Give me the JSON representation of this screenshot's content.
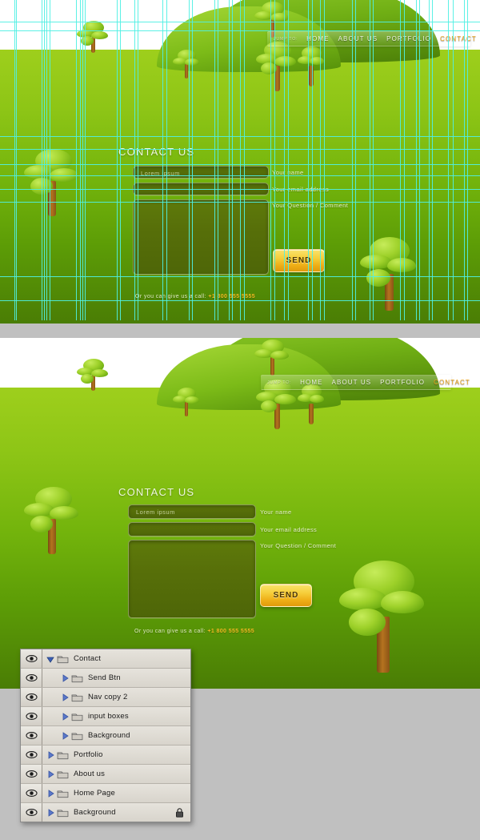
{
  "panels": {
    "top": {
      "label": "design-with-guides"
    },
    "bottom": {
      "label": "design-preview"
    }
  },
  "nav": {
    "jump_label": "JUMP TO:",
    "items": [
      {
        "label": "HOME",
        "active": false
      },
      {
        "label": "ABOUT US",
        "active": false
      },
      {
        "label": "PORTFOLIO",
        "active": false
      },
      {
        "label": "CONTACT",
        "active": true
      }
    ]
  },
  "contact": {
    "title": "CONTACT US",
    "name_value": "Lorem ipsum",
    "name_label": "Your name",
    "email_value": "",
    "email_label": "Your email address",
    "message_value": "",
    "message_label": "Your Question / Comment",
    "send_label": "SEND",
    "call_prefix": "Or you can give us a call: ",
    "call_number": "+1 800 555 5555"
  },
  "colors": {
    "accent_gold": "#f0a81d",
    "ground_top": "#9ecf1c",
    "ground_bottom": "#4a7d05",
    "guide": "#4ff0e4",
    "panel_gray": "#c0c0c0",
    "field_green": "#576f09"
  },
  "layers_panel": {
    "rows": [
      {
        "name": "Contact",
        "indent": 1,
        "expanded": true,
        "locked": false
      },
      {
        "name": "Send Btn",
        "indent": 2,
        "expanded": false,
        "locked": false
      },
      {
        "name": "Nav copy 2",
        "indent": 2,
        "expanded": false,
        "locked": false
      },
      {
        "name": "input boxes",
        "indent": 2,
        "expanded": false,
        "locked": false
      },
      {
        "name": "Background",
        "indent": 2,
        "expanded": false,
        "locked": false
      },
      {
        "name": "Portfolio",
        "indent": 1,
        "expanded": false,
        "locked": false
      },
      {
        "name": "About us",
        "indent": 1,
        "expanded": false,
        "locked": false
      },
      {
        "name": "Home Page",
        "indent": 1,
        "expanded": false,
        "locked": false
      },
      {
        "name": "Background",
        "indent": 1,
        "expanded": false,
        "locked": true
      }
    ]
  },
  "guides": {
    "vertical": [
      18,
      20,
      52,
      55,
      58,
      62,
      95,
      100,
      103,
      106,
      146,
      150,
      168,
      172,
      203,
      208,
      236,
      240,
      268,
      272,
      286,
      290,
      300,
      305,
      338,
      343,
      355,
      360,
      385,
      390,
      400,
      405,
      440,
      444,
      462,
      466,
      500,
      505,
      520,
      524,
      536,
      540,
      560,
      566,
      580,
      584
    ],
    "horizontal": [
      27,
      38,
      170,
      186,
      205,
      219,
      236,
      252,
      345,
      375
    ]
  }
}
